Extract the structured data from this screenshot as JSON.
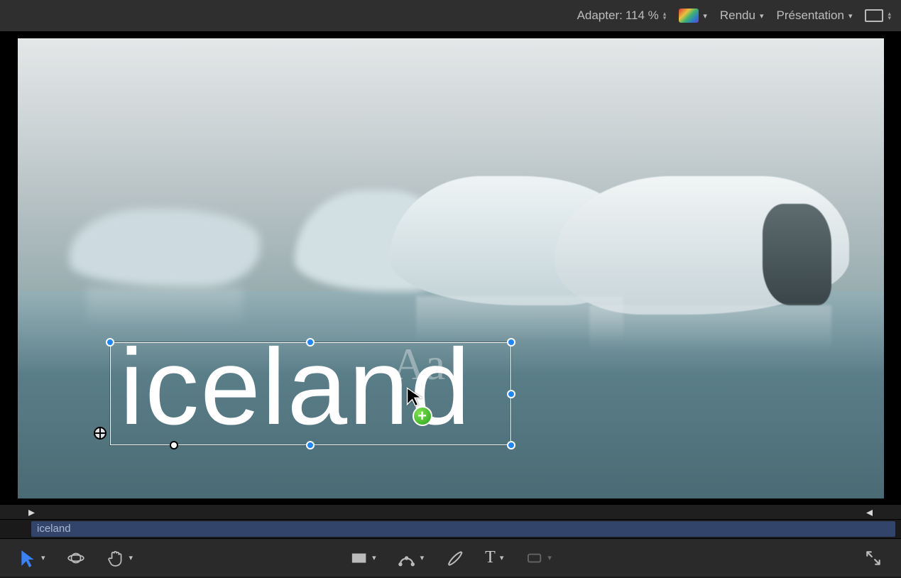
{
  "topbar": {
    "fit_label": "Adapter:",
    "zoom_value": "114 %",
    "render_label": "Rendu",
    "view_label": "Présentation"
  },
  "canvas": {
    "text_layer": {
      "content": "iceland",
      "preview_glyph": "Aa"
    },
    "drag_badge": "+"
  },
  "clip": {
    "name": "iceland"
  },
  "ruler": {
    "in_marker": "▸",
    "out_marker": "◂"
  },
  "tools": {
    "arrow": "arrow-tool",
    "orbit": "orbit-tool",
    "hand": "hand-tool",
    "rect_mask": "rectangle-mask-tool",
    "pen": "pen-tool",
    "brush": "brush-tool",
    "text": "T",
    "shape": "shape-tool"
  }
}
